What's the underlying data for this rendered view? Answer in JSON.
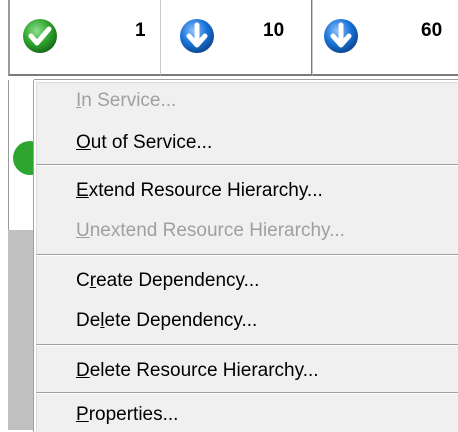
{
  "status_bar": {
    "cells": [
      {
        "icon": "green-check-icon",
        "count": "1"
      },
      {
        "icon": "blue-down-arrow-icon",
        "count": "10"
      },
      {
        "icon": "blue-down-arrow-icon",
        "count": "60"
      }
    ]
  },
  "colors": {
    "green": "#2ea52e",
    "blue": "#1a73d9",
    "menu_bg": "#f0f0f0",
    "disabled_text": "#a0a0a0"
  },
  "menu": {
    "items": [
      {
        "label_pre": "",
        "label_u": "I",
        "label_post": "n Service...",
        "disabled": true
      },
      {
        "label_pre": "",
        "label_u": "O",
        "label_post": "ut of Service...",
        "disabled": false
      },
      {
        "label_pre": "",
        "label_u": "E",
        "label_post": "xtend Resource Hierarchy...",
        "disabled": false
      },
      {
        "label_pre": "",
        "label_u": "U",
        "label_post": "nextend Resource Hierarchy...",
        "disabled": true
      },
      {
        "label_pre": "C",
        "label_u": "r",
        "label_post": "eate Dependency...",
        "disabled": false
      },
      {
        "label_pre": "De",
        "label_u": "l",
        "label_post": "ete Dependency...",
        "disabled": false
      },
      {
        "label_pre": "",
        "label_u": "D",
        "label_post": "elete Resource Hierarchy...",
        "disabled": false
      },
      {
        "label_pre": "",
        "label_u": "P",
        "label_post": "roperties...",
        "disabled": false
      }
    ]
  }
}
